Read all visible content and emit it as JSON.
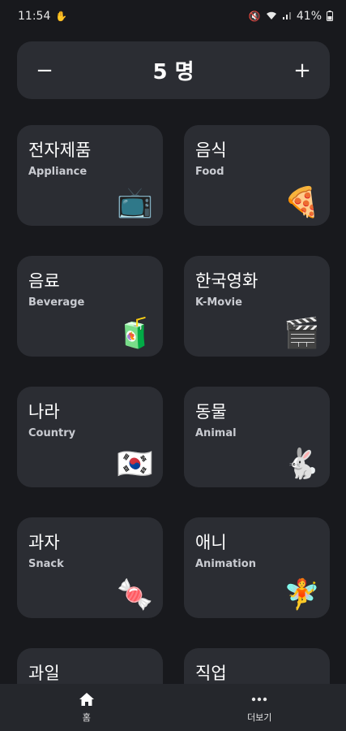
{
  "status_bar": {
    "time": "11:54",
    "battery": "41%"
  },
  "counter": {
    "minus_label": "−",
    "value": "5 명",
    "plus_label": "+"
  },
  "categories": [
    {
      "title": "전자제품",
      "subtitle": "Appliance",
      "emoji": "📺",
      "icon": "tv-icon"
    },
    {
      "title": "음식",
      "subtitle": "Food",
      "emoji": "🍕",
      "icon": "pizza-icon"
    },
    {
      "title": "음료",
      "subtitle": "Beverage",
      "emoji": "🧃",
      "icon": "juice-box-icon"
    },
    {
      "title": "한국영화",
      "subtitle": "K-Movie",
      "emoji": "🎬",
      "icon": "clapper-icon"
    },
    {
      "title": "나라",
      "subtitle": "Country",
      "emoji": "🇰🇷",
      "icon": "korea-flag-icon"
    },
    {
      "title": "동물",
      "subtitle": "Animal",
      "emoji": "🐇",
      "icon": "rabbit-icon"
    },
    {
      "title": "과자",
      "subtitle": "Snack",
      "emoji": "🍬",
      "icon": "candy-icon"
    },
    {
      "title": "애니",
      "subtitle": "Animation",
      "emoji": "🧚",
      "icon": "fairy-icon"
    },
    {
      "title": "과일",
      "subtitle": "",
      "emoji": "",
      "icon": ""
    },
    {
      "title": "직업",
      "subtitle": "",
      "emoji": "",
      "icon": ""
    }
  ],
  "bottom_nav": {
    "home_label": "홈",
    "more_label": "더보기"
  },
  "colors": {
    "background": "#18191d",
    "card": "#2b2d33",
    "nav": "#25272c"
  }
}
